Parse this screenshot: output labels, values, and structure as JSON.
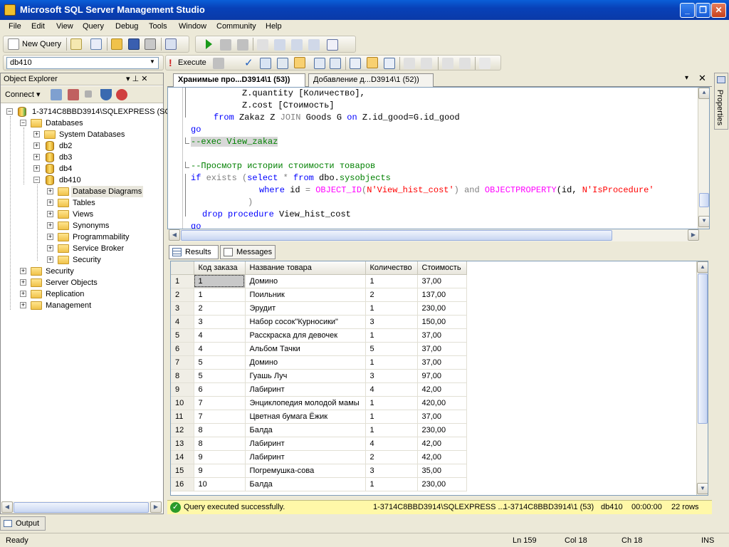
{
  "window": {
    "title": "Microsoft SQL Server Management Studio"
  },
  "menu": [
    "File",
    "Edit",
    "View",
    "Query",
    "Debug",
    "Tools",
    "Window",
    "Community",
    "Help"
  ],
  "toolbar": {
    "new_query": "New Query",
    "database": "db410",
    "execute": "Execute"
  },
  "object_explorer": {
    "title": "Object Explorer",
    "connect": "Connect ▾",
    "pin": "▾ ⊥ ✕",
    "nodes": [
      {
        "label": "1-3714C8BBD3914\\SQLEXPRESS (SQL"
      },
      {
        "label": "Databases"
      },
      {
        "label": "System Databases"
      },
      {
        "label": "db2"
      },
      {
        "label": "db3"
      },
      {
        "label": "db4"
      },
      {
        "label": "db410"
      },
      {
        "label": "Database Diagrams"
      },
      {
        "label": "Tables"
      },
      {
        "label": "Views"
      },
      {
        "label": "Synonyms"
      },
      {
        "label": "Programmability"
      },
      {
        "label": "Service Broker"
      },
      {
        "label": "Security"
      },
      {
        "label": "Security"
      },
      {
        "label": "Server Objects"
      },
      {
        "label": "Replication"
      },
      {
        "label": "Management"
      }
    ]
  },
  "tabs": [
    {
      "label": "Хранимые про...D3914\\1 (53))"
    },
    {
      "label": "Добавление д...D3914\\1 (52))"
    }
  ],
  "code": {
    "l1": "Z.quantity [Количество],",
    "l2": "Z.cost [Стоимость]",
    "l3a": "from",
    "l3b": " Zakaz Z ",
    "l3c": "JOIN",
    "l3d": " Goods G ",
    "l3e": "on",
    "l3f": " Z.id_good=G.id_good",
    "l4": "go",
    "l5": "--exec View_zakaz",
    "l6": "--Просмотр истории стоимости товаров",
    "l7a": "if",
    "l7b": " exists ",
    "l7c": "(",
    "l7d": "select",
    "l7e": " * ",
    "l7f": "from",
    "l7g": " dbo.",
    "l7h": "sysobjects",
    "l8a": "where",
    "l8b": " id ",
    "l8c": "=",
    "l8d": " OBJECT_ID",
    "l8e": "(",
    "l8f": "N'View_hist_cost'",
    "l8g": ")",
    "l8h": " and ",
    "l8i": "OBJECTPROPERTY",
    "l8j": "(id, ",
    "l8k": "N'IsProcedure'",
    "l9": ")",
    "l10a": "drop",
    "l10b": " procedure",
    "l10c": " View_hist_cost",
    "l11": "go"
  },
  "results": {
    "tab_results": "Results",
    "tab_messages": "Messages",
    "columns": [
      "Код заказа",
      "Название товара",
      "Количество",
      "Стоимость"
    ],
    "rows": [
      [
        "1",
        "1",
        "Домино",
        "1",
        "37,00"
      ],
      [
        "2",
        "1",
        "Поильник",
        "2",
        "137,00"
      ],
      [
        "3",
        "2",
        "Эрудит",
        "1",
        "230,00"
      ],
      [
        "4",
        "3",
        "Набор сосок\"Курносики\"",
        "3",
        "150,00"
      ],
      [
        "5",
        "4",
        "Расскраска для девочек",
        "1",
        "37,00"
      ],
      [
        "6",
        "4",
        "Альбом Тачки",
        "5",
        "37,00"
      ],
      [
        "7",
        "5",
        "Домино",
        "1",
        "37,00"
      ],
      [
        "8",
        "5",
        "Гуашь Луч",
        "3",
        "97,00"
      ],
      [
        "9",
        "6",
        "Лабиринт",
        "4",
        "42,00"
      ],
      [
        "10",
        "7",
        "Энциклопедия молодой мамы",
        "1",
        "420,00"
      ],
      [
        "11",
        "7",
        "Цветная бумага Ёжик",
        "1",
        "37,00"
      ],
      [
        "12",
        "8",
        "Балда",
        "1",
        "230,00"
      ],
      [
        "13",
        "8",
        "Лабиринт",
        "4",
        "42,00"
      ],
      [
        "14",
        "9",
        "Лабиринт",
        "2",
        "42,00"
      ],
      [
        "15",
        "9",
        "Погремушка-сова",
        "3",
        "35,00"
      ],
      [
        "16",
        "10",
        "Балда",
        "1",
        "230,00"
      ]
    ]
  },
  "query_status": {
    "message": "Query executed successfully.",
    "server": "1-3714C8BBD3914\\SQLEXPRESS ...",
    "user": "1-3714C8BBD3914\\1 (53)",
    "db": "db410",
    "time": "00:00:00",
    "rows": "22 rows"
  },
  "output_tab": "Output",
  "properties_tab": "Properties",
  "statusbar": {
    "ready": "Ready",
    "ln": "Ln 159",
    "col": "Col 18",
    "ch": "Ch 18",
    "ins": "INS"
  }
}
